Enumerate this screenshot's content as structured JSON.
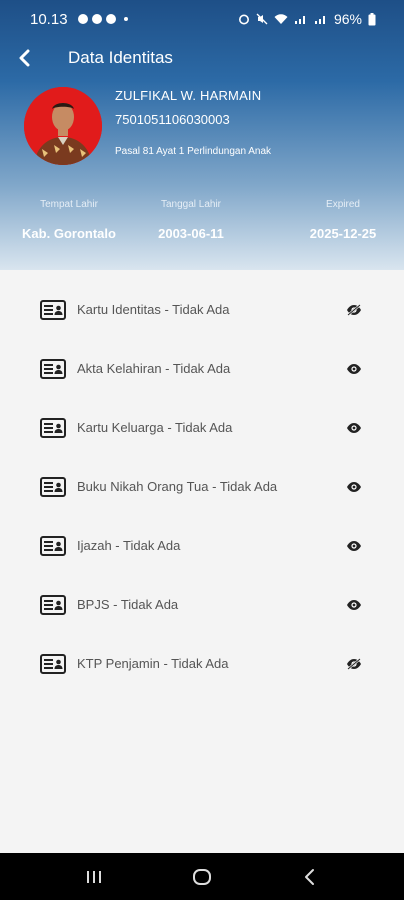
{
  "status_bar": {
    "time": "10.13",
    "battery": "96%"
  },
  "header": {
    "title": "Data Identitas",
    "back_icon": "chevron-left-icon"
  },
  "profile": {
    "name": "ZULFIKAL W. HARMAIN",
    "nik": "7501051106030003",
    "note": "Pasal 81 Ayat 1 Perlindungan Anak"
  },
  "info": {
    "birthplace_label": "Tempat Lahir",
    "birthplace": "Kab. Gorontalo",
    "birthdate_label": "Tanggal Lahir",
    "birthdate": "2003-06-11",
    "expired_label": "Expired",
    "expired": "2025-12-25"
  },
  "documents": [
    {
      "label": "Kartu Identitas - Tidak Ada",
      "icon": "eye-off-icon"
    },
    {
      "label": "Akta Kelahiran - Tidak Ada",
      "icon": "eye-icon"
    },
    {
      "label": "Kartu Keluarga - Tidak Ada",
      "icon": "eye-icon"
    },
    {
      "label": "Buku Nikah Orang Tua - Tidak Ada",
      "icon": "eye-icon"
    },
    {
      "label": "Ijazah - Tidak Ada",
      "icon": "eye-icon"
    },
    {
      "label": "BPJS - Tidak Ada",
      "icon": "eye-icon"
    },
    {
      "label": "KTP Penjamin - Tidak Ada",
      "icon": "eye-off-icon"
    }
  ],
  "colors": {
    "header_top": "#1e4f87",
    "header_bottom": "#d9e5ef",
    "avatar_bg": "#e11b1b",
    "text_gray": "#555555"
  }
}
